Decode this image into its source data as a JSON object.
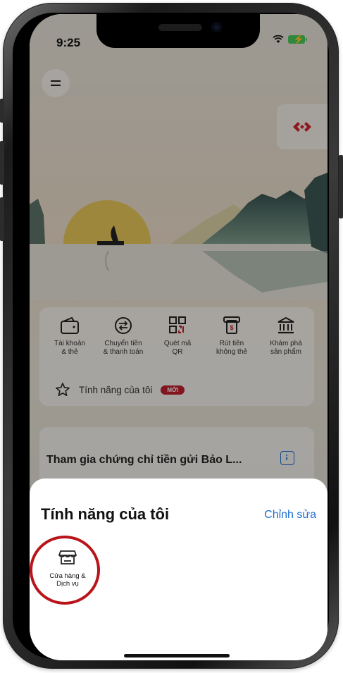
{
  "status_bar": {
    "time": "9:25"
  },
  "quick_actions": [
    {
      "label": "Tài khoản\n& thẻ",
      "icon": "wallet-icon"
    },
    {
      "label": "Chuyển tiền\n& thanh toán",
      "icon": "transfer-icon"
    },
    {
      "label": "Quét mã\nQR",
      "icon": "qr-code-icon"
    },
    {
      "label": "Rút tiền\nkhông thẻ",
      "icon": "atm-withdraw-icon"
    },
    {
      "label": "Khám phá\nsản phẩm",
      "icon": "bank-icon"
    }
  ],
  "features_row": {
    "label": "Tính năng của tôi",
    "badge": "MỚI"
  },
  "promo": {
    "title": "Tham gia chứng chỉ tiền gửi Bảo L..."
  },
  "sheet": {
    "title": "Tính năng của tôi",
    "edit_label": "Chỉnh sửa",
    "items": [
      {
        "label": "Cửa hàng &\nDịch vụ",
        "icon": "store-icon"
      }
    ]
  },
  "colors": {
    "accent": "#1f6fd0",
    "brand_red": "#c0202f",
    "highlight": "#b8141a"
  }
}
